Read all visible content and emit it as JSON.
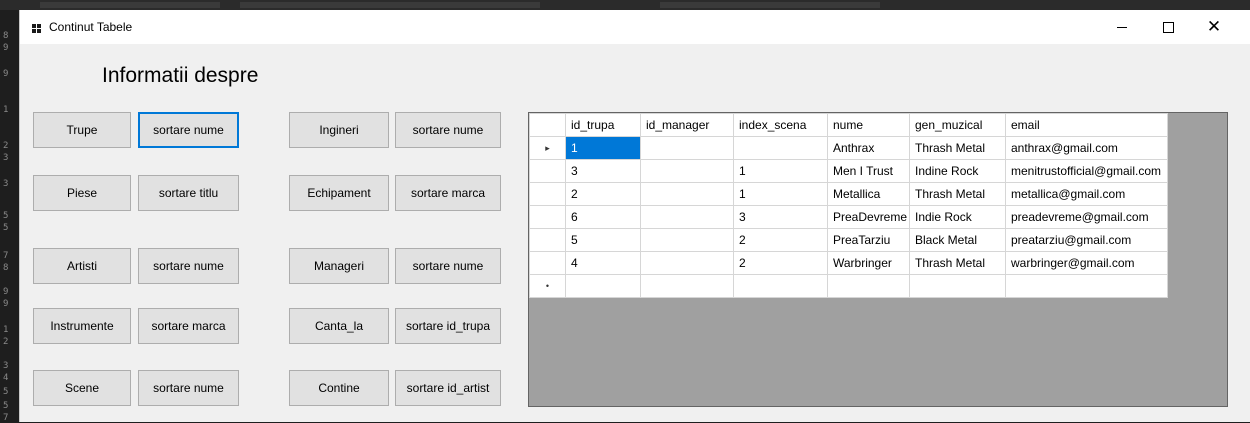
{
  "window": {
    "title": "Continut Tabele"
  },
  "gutter": {
    "numbers": [
      "8",
      "9",
      "9",
      "1",
      "2",
      "3",
      "3",
      "5",
      "5",
      "7",
      "8",
      "9",
      "9",
      "1",
      "2",
      "3",
      "4",
      "5",
      "5",
      "7"
    ]
  },
  "heading": "Informatii despre",
  "buttons": {
    "trupe": "Trupe",
    "sortare_nume_1": "sortare nume",
    "piese": "Piese",
    "sortare_titlu": "sortare titlu",
    "artisti": "Artisti",
    "sortare_nume_2": "sortare nume",
    "instrumente": "Instrumente",
    "sortare_marca_1": "sortare marca",
    "scene": "Scene",
    "sortare_nume_3": "sortare nume",
    "ingineri": "Ingineri",
    "sortare_nume_4": "sortare nume",
    "echipament": "Echipament",
    "sortare_marca_2": "sortare marca",
    "manageri": "Manageri",
    "sortare_nume_5": "sortare nume",
    "canta_la": "Canta_la",
    "sortare_id_trupa": "sortare id_trupa",
    "contine": "Contine",
    "sortare_id_artist": "sortare id_artist"
  },
  "grid": {
    "columns": [
      "id_trupa",
      "id_manager",
      "index_scena",
      "nume",
      "gen_muzical",
      "email"
    ],
    "rows": [
      [
        "1",
        "",
        "",
        "Anthrax",
        "Thrash Metal",
        "anthrax@gmail.com"
      ],
      [
        "3",
        "",
        "1",
        "Men I Trust",
        "Indine Rock",
        "menitrustofficial@gmail.com"
      ],
      [
        "2",
        "",
        "1",
        "Metallica",
        "Thrash Metal",
        "metallica@gmail.com"
      ],
      [
        "6",
        "",
        "3",
        "PreaDevreme",
        "Indie Rock",
        "preadevreme@gmail.com"
      ],
      [
        "5",
        "",
        "2",
        "PreaTarziu",
        "Black Metal",
        "preatarziu@gmail.com"
      ],
      [
        "4",
        "",
        "2",
        "Warbringer",
        "Thrash Metal",
        "warbringer@gmail.com"
      ]
    ],
    "current_row_marker": "▸",
    "new_row_marker": "•"
  }
}
